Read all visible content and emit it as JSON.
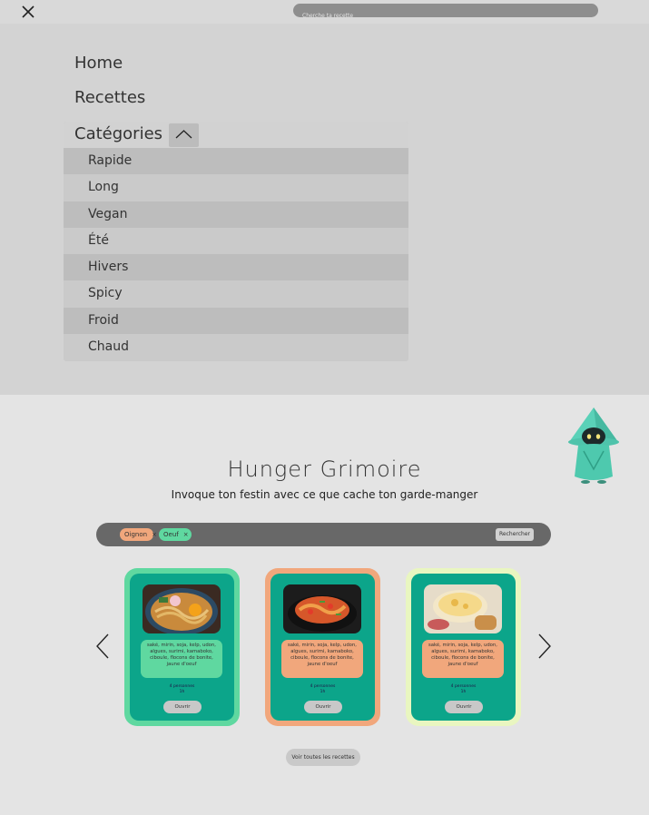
{
  "topbar": {
    "search_placeholder": "Cherche ta recette"
  },
  "menu": {
    "home_label": "Home",
    "recettes_label": "Recettes",
    "categories_label": "Catégories",
    "categories": [
      "Rapide",
      "Long",
      "Vegan",
      "Été",
      "Hivers",
      "Spicy",
      "Froid",
      "Chaud"
    ]
  },
  "hero": {
    "title": "Hunger Grimoire",
    "subtitle": "Invoque ton festin avec ce que cache ton garde-manger"
  },
  "ingredients": {
    "chips": [
      {
        "label": "Oignon",
        "remove": "×",
        "color": "#f1a77c"
      },
      {
        "label": "Oeuf",
        "remove": "×",
        "color": "#5fd8a0"
      }
    ],
    "search_label": "Rechercher"
  },
  "cards": [
    {
      "description": "saké, mirin, soja, kelp, udon, algues, surimi, kamaboko, ciboule, flocons de bonite, jaune d'oeuf",
      "persons": "4 personnes",
      "time": "1h",
      "open_label": "Ouvrir",
      "frame_color": "#5fd8a0"
    },
    {
      "description": "saké, mirin, soja, kelp, udon, algues, surimi, kamaboko, ciboule, flocons de bonite, jaune d'oeuf",
      "persons": "4 personnes",
      "time": "1h",
      "open_label": "Ouvrir",
      "frame_color": "#f1a77c"
    },
    {
      "description": "saké, mirin, soja, kelp, udon, algues, surimi, kamaboko, ciboule, flocons de bonite, jaune d'oeuf",
      "persons": "4 personnes",
      "time": "1h",
      "open_label": "Ouvrir",
      "frame_color": "#e9f6c0"
    }
  ],
  "all_recipes_label": "Voir toutes les recettes",
  "icons": {
    "close": "close-icon",
    "toggle": "chevron-up-icon",
    "prev": "chevron-left-icon",
    "next": "chevron-right-icon"
  },
  "colors": {
    "accent_green": "#5fd8a0",
    "accent_orange": "#f1a77c",
    "card_teal": "#0ca58a"
  }
}
